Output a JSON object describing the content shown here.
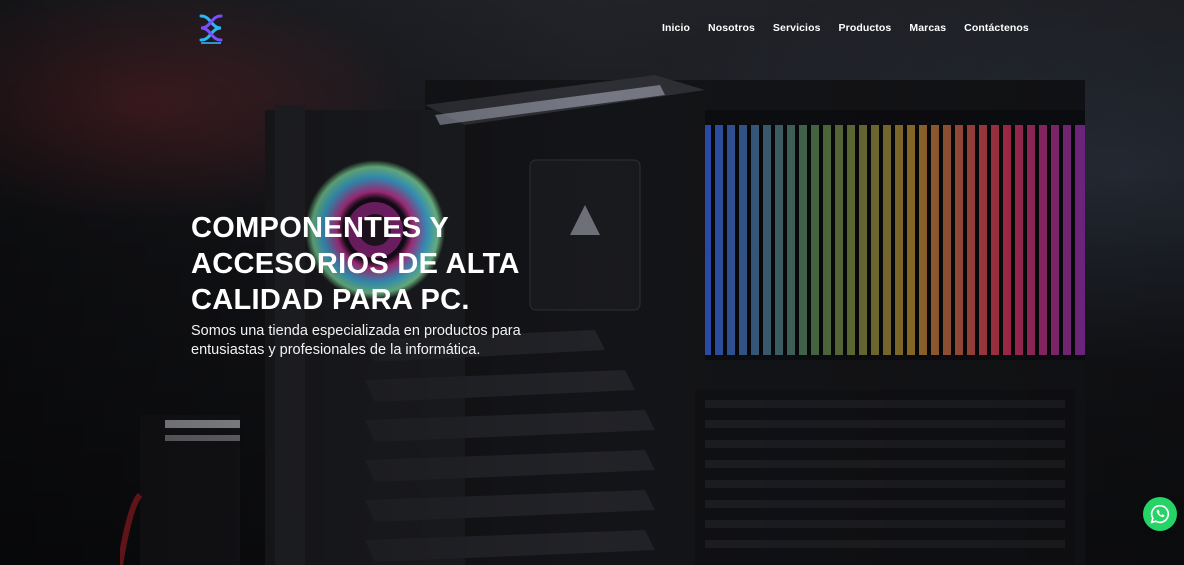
{
  "brand": {
    "logo_icon": "cross-loop-logo-icon",
    "logo_text": "",
    "accent_color": "#29b6f6",
    "accent_color_2": "#7c4dff"
  },
  "nav": {
    "items": [
      {
        "label": "Inicio"
      },
      {
        "label": "Nosotros"
      },
      {
        "label": "Servicios"
      },
      {
        "label": "Productos"
      },
      {
        "label": "Marcas"
      },
      {
        "label": "Contáctenos"
      }
    ]
  },
  "hero": {
    "title_lines": [
      "COMPONENTES Y",
      "ACCESORIOS DE ALTA",
      "CALIDAD PARA PC."
    ],
    "subtitle_lines": [
      "Somos una tienda especializada en productos para",
      "entusiastas y profesionales de la informática."
    ],
    "background_icon": "motherboard-hardware-image"
  },
  "whatsapp": {
    "icon": "whatsapp-icon",
    "color": "#25d366"
  }
}
